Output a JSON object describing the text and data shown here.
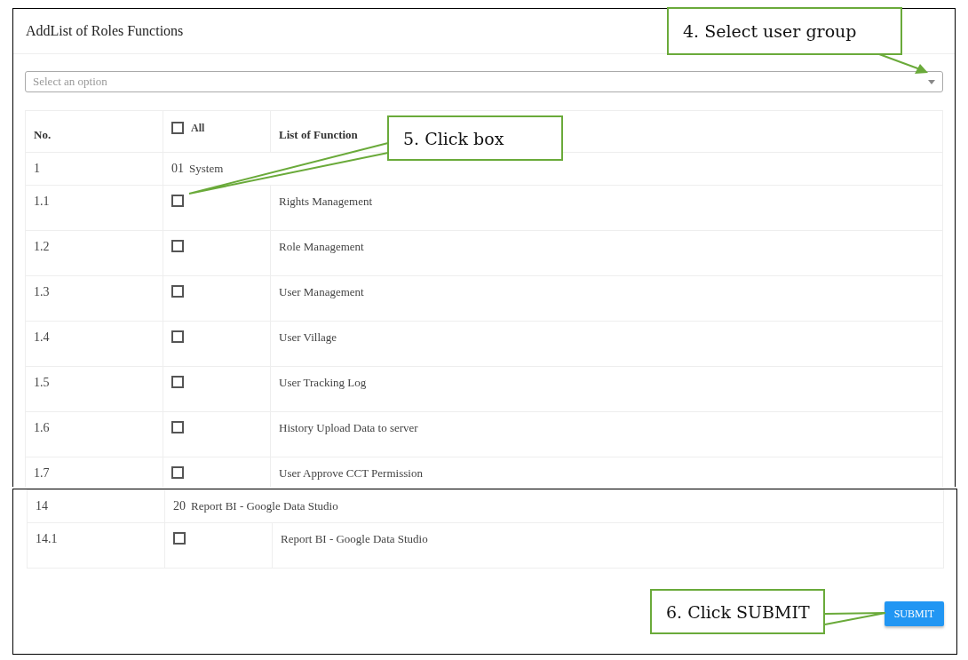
{
  "top": {
    "title": "AddList of Roles Functions",
    "select": {
      "placeholder": "Select an option"
    },
    "table": {
      "columns": {
        "no": "No.",
        "all": {
          "label": "All",
          "checked": false
        },
        "function": "List of Function"
      },
      "groups": [
        {
          "no": "1",
          "code": "01",
          "name": "System",
          "items": [
            {
              "no": "1.1",
              "label": "Rights Management",
              "checked": false
            },
            {
              "no": "1.2",
              "label": "Role Management",
              "checked": false
            },
            {
              "no": "1.3",
              "label": "User Management",
              "checked": false
            },
            {
              "no": "1.4",
              "label": "User Village",
              "checked": false
            },
            {
              "no": "1.5",
              "label": "User Tracking Log",
              "checked": false
            },
            {
              "no": "1.6",
              "label": "History Upload Data to server",
              "checked": false
            },
            {
              "no": "1.7",
              "label": "User Approve CCT Permission",
              "checked": false
            }
          ]
        }
      ]
    }
  },
  "bottom": {
    "groups": [
      {
        "no": "14",
        "code": "20",
        "name": "Report BI - Google Data Studio",
        "items": [
          {
            "no": "14.1",
            "label": "Report BI - Google Data Studio",
            "checked": false
          }
        ]
      }
    ],
    "submit": "SUBMIT"
  },
  "callouts": [
    {
      "kind": "select",
      "text": "4. Select user group"
    },
    {
      "kind": "checkbox",
      "text": "5. Click box"
    },
    {
      "kind": "submit",
      "text": "6. Click SUBMIT"
    }
  ]
}
